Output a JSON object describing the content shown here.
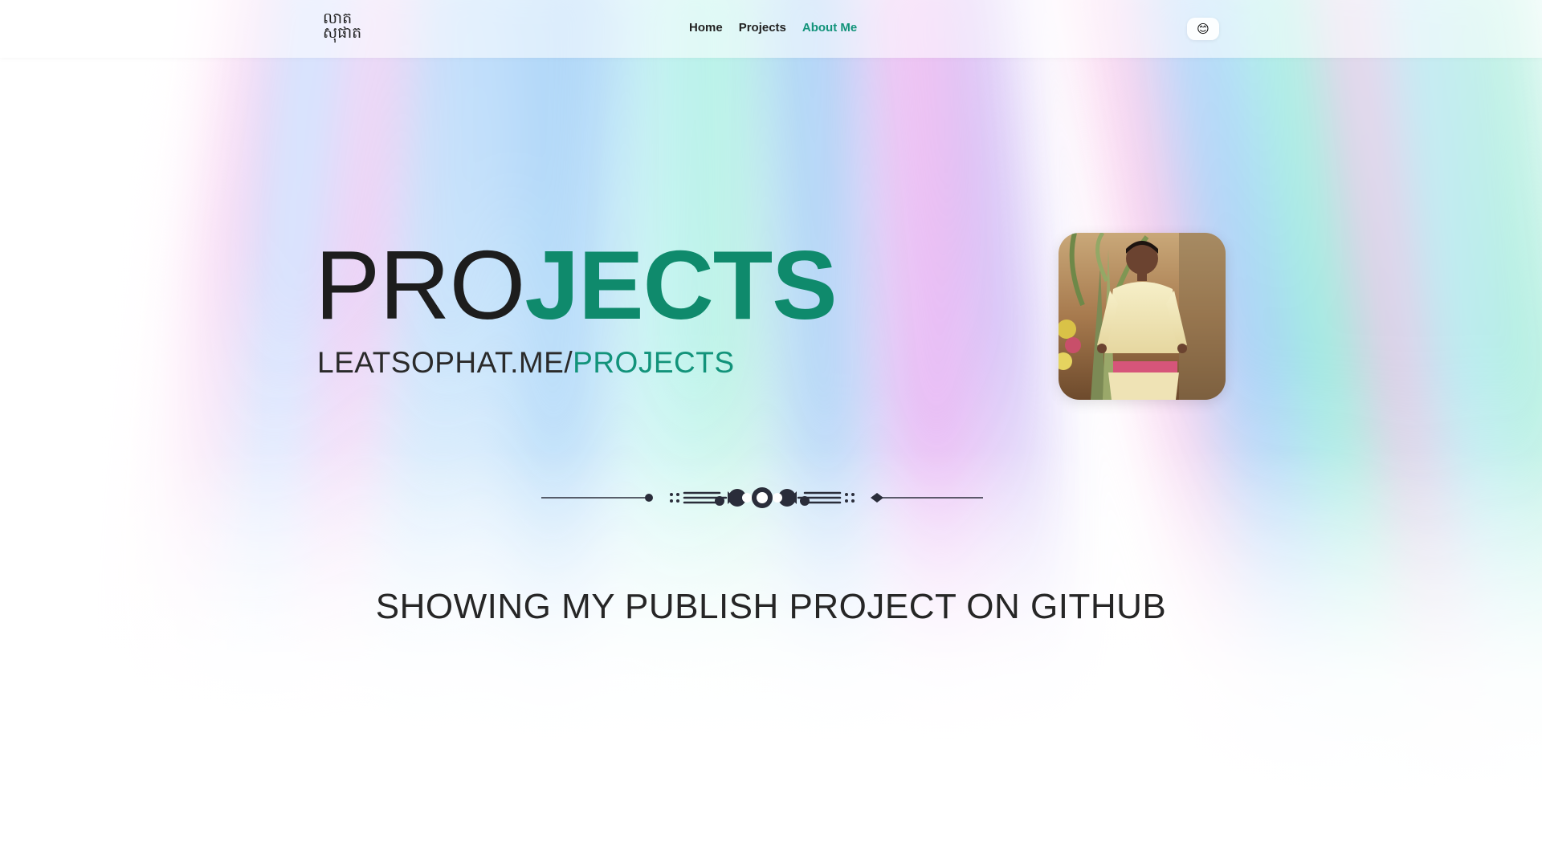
{
  "navbar": {
    "logo": {
      "line1": "លាត",
      "line2": "សុផាត",
      "icon": "khmer-name-logo"
    },
    "links": [
      {
        "label": "Home",
        "active": false
      },
      {
        "label": "Projects",
        "active": false
      },
      {
        "label": "About Me",
        "active": true
      }
    ],
    "theme_toggle": {
      "icon": "smiling-face-emoji",
      "glyph": "😊"
    }
  },
  "hero": {
    "title_part1": "PRO",
    "title_part2": "JECTS",
    "subtitle_domain": "LEATSOPHAT.ME/",
    "subtitle_path": "PROJECTS",
    "avatar": {
      "icon": "profile-photo"
    }
  },
  "divider": {
    "icon": "ornamental-divider-icon"
  },
  "tagline": "SHOWING MY PUBLISH PROJECT ON GITHUB",
  "colors": {
    "accent": "#12937a",
    "accent_dark": "#0f8a6c",
    "text": "#1d1d1d"
  }
}
